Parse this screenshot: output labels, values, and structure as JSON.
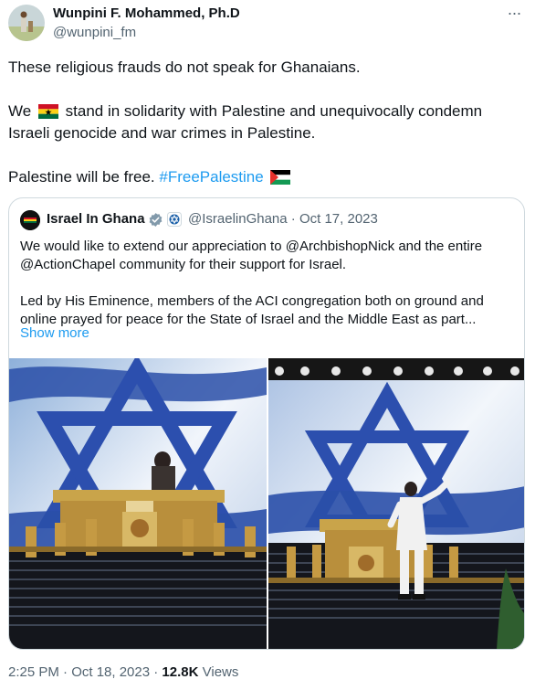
{
  "author": {
    "name": "Wunpini F. Mohammed, Ph.D",
    "handle": "@wunpini_fm"
  },
  "more_icon": "more-horizontal-icon",
  "tweet": {
    "line1": "These religious frauds do not speak for Ghanaians.",
    "line2_prefix": "We",
    "line2_suffix": "stand in solidarity with Palestine and unequivocally condemn",
    "line3": "Israeli genocide and war crimes in Palestine.",
    "line4_prefix": "Palestine will be free.",
    "hashtag": "#FreePalestine"
  },
  "quote": {
    "name": "Israel In Ghana",
    "handle_date": "@IsraelinGhana · Oct 17, 2023",
    "lines": [
      "We would like to extend our appreciation to @ArchbishopNick  and the entire",
      "@ActionChapel community for their support for Israel.",
      "Led by  His Eminence, members of the ACI congregation both on ground and",
      "online prayed for peace for the State of Israel and the Middle East as part..."
    ],
    "show_more": "Show more"
  },
  "footer": {
    "time_date": "2:25 PM · Oct 18, 2023 · ",
    "views_count": "12.8K",
    "views_label": "Views"
  },
  "colors": {
    "text": "#0f1419",
    "secondary": "#536471",
    "link": "#1d9bf0",
    "border": "#cfd9de",
    "verified": "#829aab"
  }
}
